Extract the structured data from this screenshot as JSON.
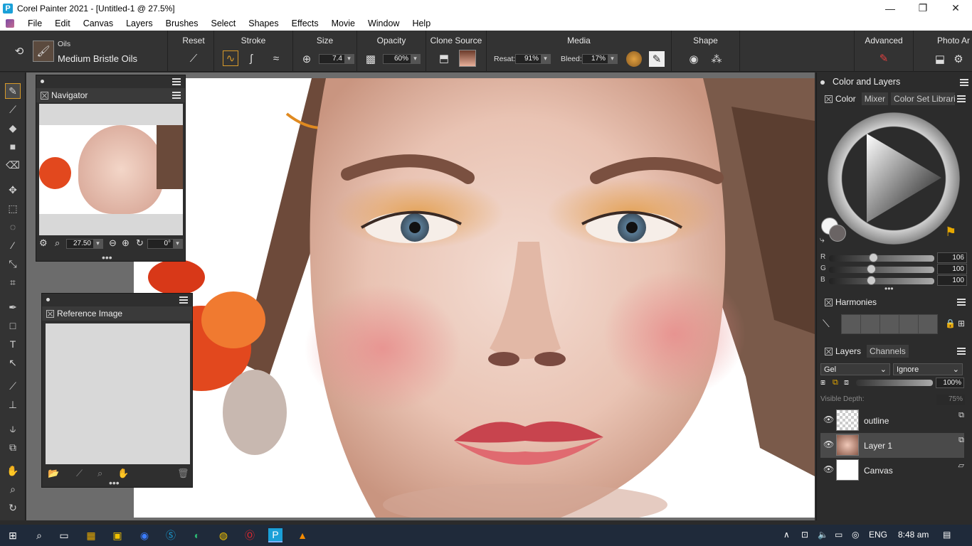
{
  "window": {
    "title": "Corel Painter 2021 - [Untitled-1 @ 27.5%]",
    "minimize": "—",
    "restore": "❐",
    "close": "✕"
  },
  "menu": [
    "File",
    "Edit",
    "Canvas",
    "Layers",
    "Brushes",
    "Select",
    "Shapes",
    "Effects",
    "Movie",
    "Window",
    "Help"
  ],
  "propbar": {
    "brush_category": "Oils",
    "brush_variant": "Medium Bristle Oils",
    "reset_label": "Reset",
    "stroke_label": "Stroke",
    "size_label": "Size",
    "size_value": "7.4",
    "opacity_label": "Opacity",
    "opacity_value": "60%",
    "clone_source_label": "Clone Source",
    "media_label": "Media",
    "resat_label": "Resat:",
    "resat_value": "91%",
    "bleed_label": "Bleed:",
    "bleed_value": "17%",
    "shape_label": "Shape",
    "advanced_label": "Advanced",
    "photo_art_label": "Photo Ar"
  },
  "navigator": {
    "title": "Navigator",
    "zoom_value": "27.50",
    "rotation_value": "0°"
  },
  "reference": {
    "title": "Reference Image"
  },
  "dock": {
    "title": "Color and Layers",
    "color_tabs": [
      "Color",
      "Mixer",
      "Color Set Librarie"
    ],
    "rgb": [
      {
        "label": "R",
        "value": "106",
        "fraction": 0.42
      },
      {
        "label": "G",
        "value": "100",
        "fraction": 0.4
      },
      {
        "label": "B",
        "value": "100",
        "fraction": 0.4
      }
    ],
    "harmonies_title": "Harmonies",
    "layers_tabs": [
      "Layers",
      "Channels"
    ],
    "composite_method": "Gel",
    "composite_depth": "Ignore",
    "opacity_value": "100%",
    "visible_depth_label": "Visible Depth:",
    "visible_depth_value": "75%",
    "layers": [
      {
        "name": "outline",
        "selected": false
      },
      {
        "name": "Layer 1",
        "selected": true
      },
      {
        "name": "Canvas",
        "selected": false
      }
    ]
  },
  "taskbar": {
    "language": "ENG",
    "time": "8:48 am"
  },
  "colors": {
    "accent": "#d89a2a",
    "panel": "#2f2f2f",
    "workspace": "#6c6c6c"
  }
}
